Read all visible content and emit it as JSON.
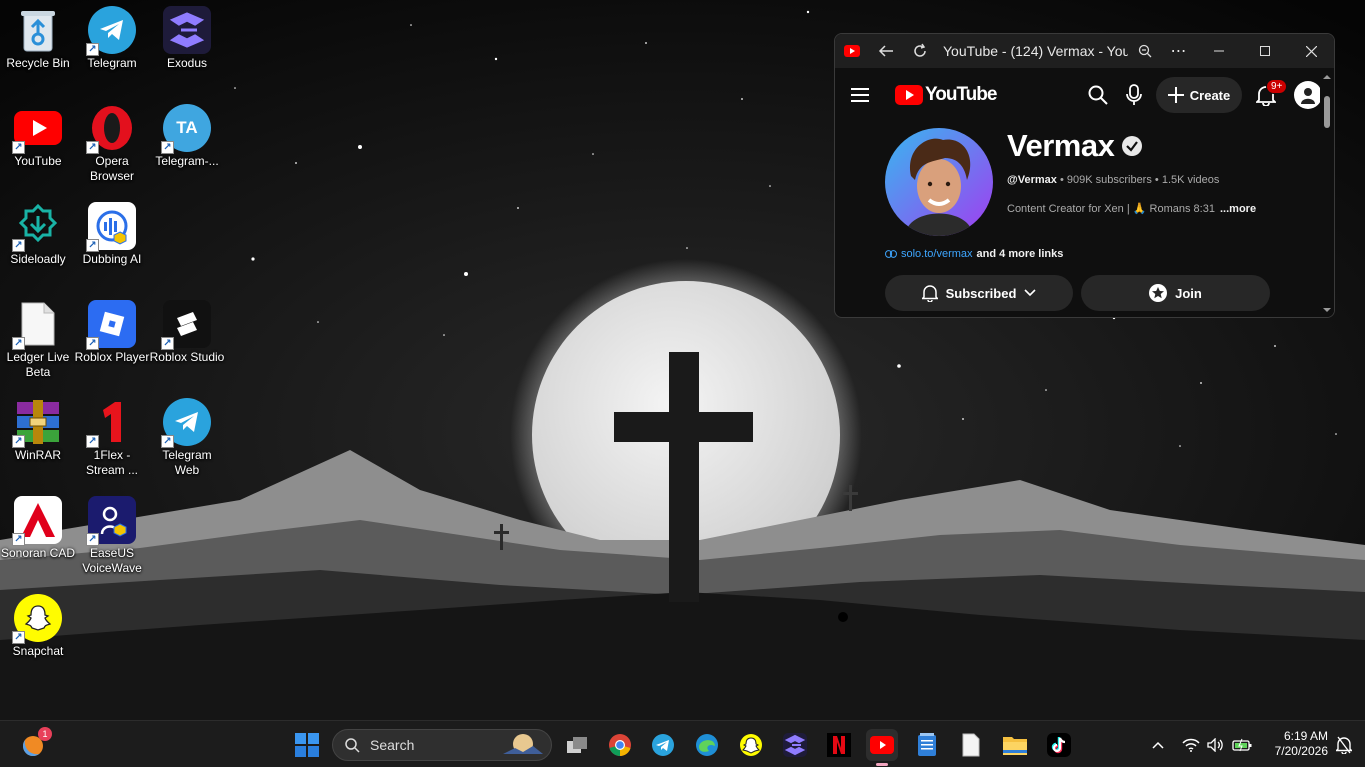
{
  "desktop": {
    "icons": [
      {
        "label": "Recycle Bin",
        "icon": "recycle-bin-icon"
      },
      {
        "label": "Telegram",
        "icon": "telegram-icon"
      },
      {
        "label": "Exodus",
        "icon": "exodus-icon"
      },
      {
        "label": "YouTube",
        "icon": "youtube-icon"
      },
      {
        "label": "Opera Browser",
        "icon": "opera-icon"
      },
      {
        "label": "Telegram-...",
        "icon": "telegram-translator-icon"
      },
      {
        "label": "Sideloadly",
        "icon": "sideloadly-icon"
      },
      {
        "label": "Dubbing AI",
        "icon": "dubbing-ai-icon"
      },
      {
        "label": "Ledger Live Beta",
        "icon": "blank-file-icon"
      },
      {
        "label": "Roblox Player",
        "icon": "roblox-player-icon"
      },
      {
        "label": "Roblox Studio",
        "icon": "roblox-studio-icon"
      },
      {
        "label": "WinRAR",
        "icon": "winrar-icon"
      },
      {
        "label": "1Flex - Stream ...",
        "icon": "oneflex-icon"
      },
      {
        "label": "Telegram Web",
        "icon": "telegram-web-icon"
      },
      {
        "label": "Sonoran CAD",
        "icon": "sonoran-cad-icon"
      },
      {
        "label": "EaseUS VoiceWave",
        "icon": "easeus-voicewave-icon"
      },
      {
        "label": "Snapchat",
        "icon": "snapchat-icon"
      }
    ]
  },
  "window": {
    "title": "YouTube - (124) Vermax - You...",
    "header": {
      "logo_text": "YouTube",
      "create_label": "Create",
      "notification_badge": "9+"
    },
    "channel": {
      "name": "Vermax",
      "handle": "@Vermax",
      "subscribers": "909K subscribers",
      "videos": "1.5K videos",
      "description": "Content Creator for Xen | 🙏 Romans 8:31",
      "more": "...more",
      "link": "solo.to/vermax",
      "more_links": "and 4 more links",
      "subscribed_label": "Subscribed",
      "join_label": "Join"
    }
  },
  "taskbar": {
    "search_placeholder": "Search",
    "widget_badge": "1",
    "time": "6:19 AM",
    "date": "7/20/2026"
  },
  "colors": {
    "youtube_red": "#ff0000",
    "windows_blue": "#0078d4",
    "link_blue": "#3ea6ff"
  }
}
